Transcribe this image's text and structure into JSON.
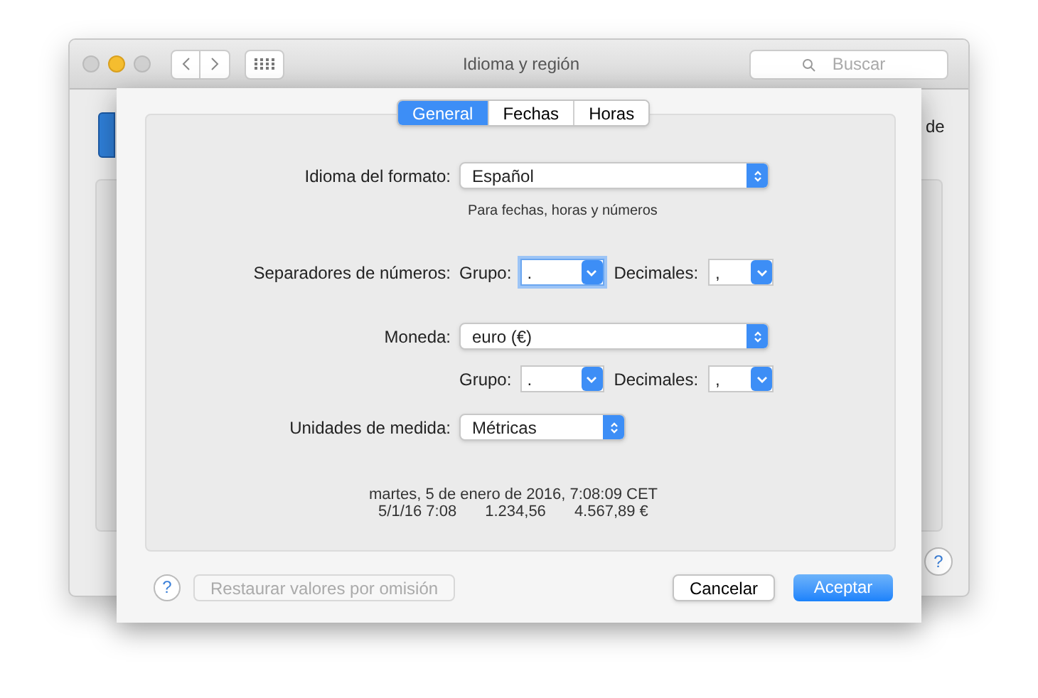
{
  "background_window": {
    "title": "Idioma y región",
    "search": {
      "placeholder": "Buscar"
    },
    "side_text": "de",
    "help_label": "?"
  },
  "sheet": {
    "tabs": [
      {
        "label": "General",
        "selected": true
      },
      {
        "label": "Fechas",
        "selected": false
      },
      {
        "label": "Horas",
        "selected": false
      }
    ],
    "rows": [
      {
        "kind": "popup",
        "label": "Idioma del formato:",
        "value": "Español",
        "note": "Para fechas, horas y números"
      },
      {
        "kind": "separators",
        "label": "Separadores de números:",
        "group_label": "Grupo:",
        "group_value": ".",
        "group_focused": true,
        "decimal_label": "Decimales:",
        "decimal_value": ","
      },
      {
        "kind": "popup",
        "label": "Moneda:",
        "value": "euro (€)"
      },
      {
        "kind": "separators",
        "group_label": "Grupo:",
        "group_value": ".",
        "group_focused": false,
        "decimal_label": "Decimales:",
        "decimal_value": ","
      },
      {
        "kind": "short_popup",
        "label": "Unidades de medida:",
        "value": "Métricas"
      }
    ],
    "samples": [
      [
        "martes, 5 de enero de 2016, 7:08:09 CET"
      ],
      [
        "5/1/16 7:08",
        "1.234,56",
        "4.567,89 €"
      ]
    ],
    "buttons": [
      {
        "kind": "help",
        "label": "?"
      },
      {
        "kind": "secondary",
        "label": "Restaurar valores por omisión",
        "disabled": true
      },
      {
        "kind": "secondary",
        "label": "Cancelar",
        "disabled": false
      },
      {
        "kind": "default",
        "label": "Aceptar",
        "disabled": false
      }
    ]
  }
}
